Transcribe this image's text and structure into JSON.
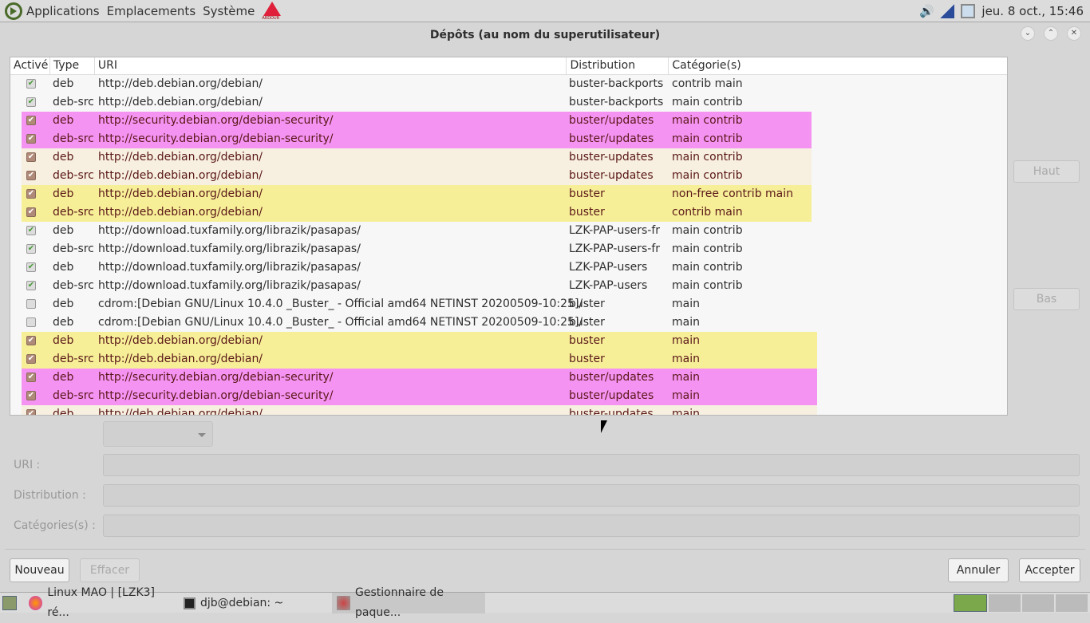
{
  "topbar": {
    "menus": [
      "Applications",
      "Emplacements",
      "Système"
    ],
    "ardour": "ARDOUR",
    "clock": "jeu.  8 oct., 15:46"
  },
  "window": {
    "title": "Dépôts (au nom du superutilisateur)"
  },
  "table": {
    "columns": [
      "Activé",
      "Type",
      "URI",
      "Distribution",
      "Catégorie(s)"
    ],
    "rows": [
      {
        "active": true,
        "type": "deb",
        "uri": "http://deb.debian.org/debian/",
        "dist": "buster-backports",
        "cat": "contrib main",
        "color": ""
      },
      {
        "active": true,
        "type": "deb-src",
        "uri": "http://deb.debian.org/debian/",
        "dist": "buster-backports",
        "cat": "main contrib",
        "color": ""
      },
      {
        "active": true,
        "type": "deb",
        "uri": "http://security.debian.org/debian-security/",
        "dist": "buster/updates",
        "cat": "main contrib",
        "color": "#f593f3"
      },
      {
        "active": true,
        "type": "deb-src",
        "uri": "http://security.debian.org/debian-security/",
        "dist": "buster/updates",
        "cat": "main contrib",
        "color": "#f593f3"
      },
      {
        "active": true,
        "type": "deb",
        "uri": "http://deb.debian.org/debian/",
        "dist": "buster-updates",
        "cat": "main contrib",
        "color": "#f7efdf"
      },
      {
        "active": true,
        "type": "deb-src",
        "uri": "http://deb.debian.org/debian/",
        "dist": "buster-updates",
        "cat": "main contrib",
        "color": "#f7efdf"
      },
      {
        "active": true,
        "type": "deb",
        "uri": "http://deb.debian.org/debian/",
        "dist": "buster",
        "cat": "non-free contrib main",
        "color": "#f7ef98"
      },
      {
        "active": true,
        "type": "deb-src",
        "uri": "http://deb.debian.org/debian/",
        "dist": "buster",
        "cat": "contrib main",
        "color": "#f7ef98"
      },
      {
        "active": true,
        "type": "deb",
        "uri": "http://download.tuxfamily.org/librazik/pasapas/",
        "dist": "LZK-PAP-users-fr",
        "cat": "main contrib",
        "color": ""
      },
      {
        "active": true,
        "type": "deb-src",
        "uri": "http://download.tuxfamily.org/librazik/pasapas/",
        "dist": "LZK-PAP-users-fr",
        "cat": "main contrib",
        "color": ""
      },
      {
        "active": true,
        "type": "deb",
        "uri": "http://download.tuxfamily.org/librazik/pasapas/",
        "dist": "LZK-PAP-users",
        "cat": "main contrib",
        "color": ""
      },
      {
        "active": true,
        "type": "deb-src",
        "uri": "http://download.tuxfamily.org/librazik/pasapas/",
        "dist": "LZK-PAP-users",
        "cat": "main contrib",
        "color": ""
      },
      {
        "active": false,
        "type": "deb",
        "uri": "cdrom:[Debian GNU/Linux 10.4.0 _Buster_ - Official amd64 NETINST 20200509-10:25]/",
        "dist": "buster",
        "cat": "main",
        "color": ""
      },
      {
        "active": false,
        "type": "deb",
        "uri": "cdrom:[Debian GNU/Linux 10.4.0 _Buster_ - Official amd64 NETINST 20200509-10:25]/",
        "dist": "buster",
        "cat": "main",
        "color": ""
      },
      {
        "active": true,
        "type": "deb",
        "uri": "http://deb.debian.org/debian/",
        "dist": "buster",
        "cat": "main",
        "color": "#f7ef98"
      },
      {
        "active": true,
        "type": "deb-src",
        "uri": "http://deb.debian.org/debian/",
        "dist": "buster",
        "cat": "main",
        "color": "#f7ef98"
      },
      {
        "active": true,
        "type": "deb",
        "uri": "http://security.debian.org/debian-security/",
        "dist": "buster/updates",
        "cat": "main",
        "color": "#f593f3"
      },
      {
        "active": true,
        "type": "deb-src",
        "uri": "http://security.debian.org/debian-security/",
        "dist": "buster/updates",
        "cat": "main",
        "color": "#f593f3"
      },
      {
        "active": true,
        "type": "deb",
        "uri": "http://deb.debian.org/debian/",
        "dist": "buster-updates",
        "cat": "main",
        "color": "#f7efdf"
      }
    ]
  },
  "side": {
    "up": "Haut",
    "down": "Bas"
  },
  "form": {
    "uri_label": "URI :",
    "dist_label": "Distribution :",
    "cat_label": "Catégories(s) :"
  },
  "buttons": {
    "new": "Nouveau",
    "delete": "Effacer",
    "cancel": "Annuler",
    "accept": "Accepter"
  },
  "taskbar": {
    "tasks": [
      "Linux MAO | [LZK3] ré...",
      "djb@debian: ~",
      "Gestionnaire de paque..."
    ]
  }
}
